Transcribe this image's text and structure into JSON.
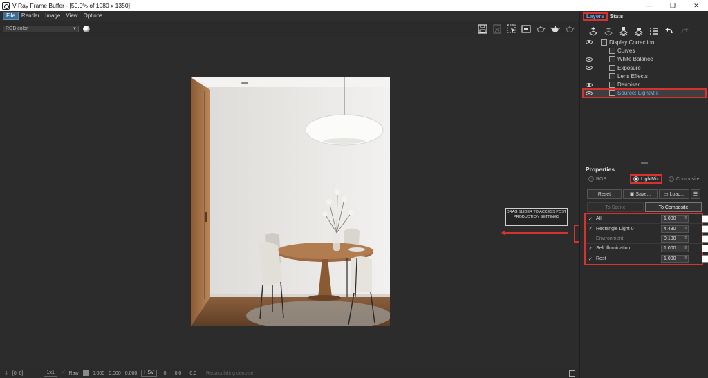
{
  "window": {
    "title": "V-Ray Frame Buffer - [50.0% of 1080 x 1350]",
    "controls": [
      "—",
      "❐",
      "✕"
    ]
  },
  "menu": [
    "File",
    "Render",
    "Image",
    "View",
    "Options"
  ],
  "toolbar": {
    "channel": "RGB color",
    "icons": [
      "save-icon",
      "clear-icon",
      "region-icon",
      "display-icon",
      "teapot-icon",
      "teapot-region-icon",
      "teapot-stop-icon"
    ]
  },
  "hint": {
    "text": "DRAG SLIDER TO ACCESS POST PRODUCTION SETTINGS"
  },
  "statusbar": {
    "coords": "[0, 0]",
    "zoom": "1x1",
    "raw_label": "Raw",
    "r": "0.000",
    "g": "0.000",
    "b": "0.000",
    "mode": "HSV",
    "h": "0",
    "s": "0.0",
    "v": "0.0",
    "status": "Recalculating denoise"
  },
  "panel": {
    "tabs": [
      "Layers",
      "Stats"
    ],
    "layers": [
      {
        "label": "Display Correction",
        "eye": true,
        "indent": 0,
        "icon": "display-correction-icon"
      },
      {
        "label": "Curves",
        "eye": false,
        "indent": 1,
        "icon": "curves-icon"
      },
      {
        "label": "White Balance",
        "eye": true,
        "indent": 1,
        "icon": "white-balance-icon"
      },
      {
        "label": "Exposure",
        "eye": true,
        "indent": 1,
        "icon": "exposure-icon"
      },
      {
        "label": "Lens Effects",
        "eye": false,
        "indent": 1,
        "icon": "lens-effects-icon"
      },
      {
        "label": "Denoiser",
        "eye": true,
        "indent": 1,
        "icon": "denoiser-icon"
      },
      {
        "label": "Source: LightMix",
        "eye": true,
        "indent": 1,
        "icon": "lightmix-icon",
        "selected": true
      }
    ],
    "properties_title": "Properties",
    "modes": [
      "RGB",
      "LightMix",
      "Composite"
    ],
    "selected_mode": "LightMix",
    "buttons": {
      "reset": "Reset",
      "save": "Save...",
      "load": "Load..."
    },
    "to_scene": "To Scene",
    "to_composite": "To Composite",
    "lights": [
      {
        "name": "All",
        "checked": true,
        "value": "1.000"
      },
      {
        "name": "Rectangle Light 0",
        "checked": true,
        "value": "4.430"
      },
      {
        "name": "Environment",
        "checked": false,
        "value": "0.100"
      },
      {
        "name": "Self Illumination",
        "checked": true,
        "value": "1.000"
      },
      {
        "name": "Rest",
        "checked": true,
        "value": "1.000"
      }
    ]
  }
}
